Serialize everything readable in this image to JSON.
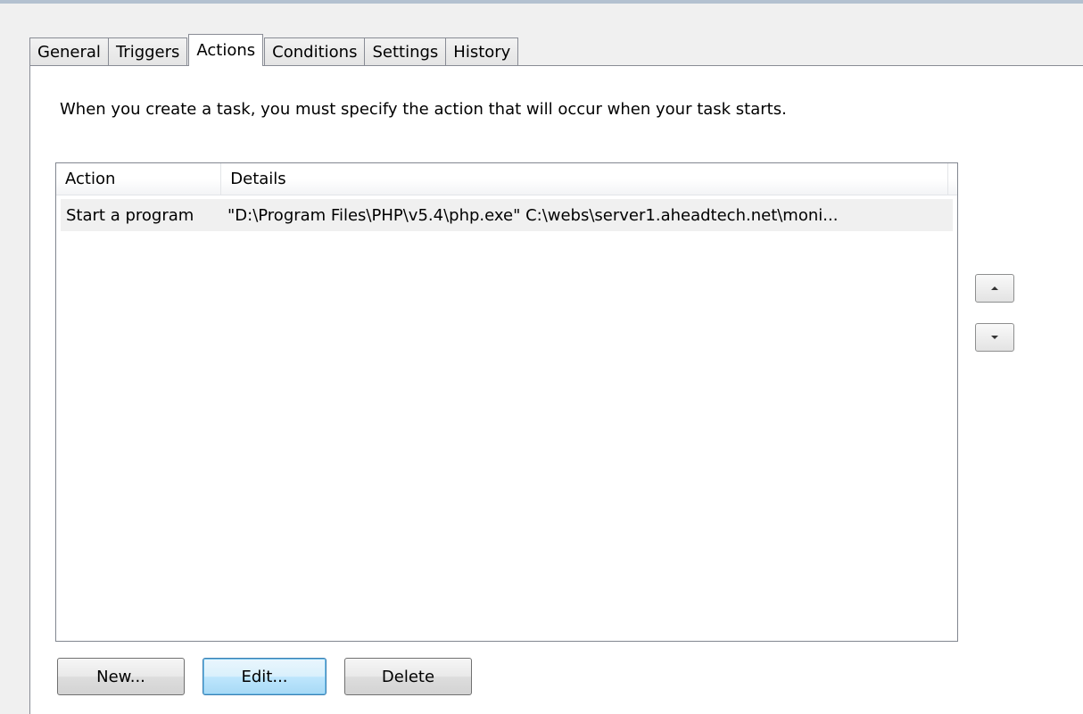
{
  "tabs": [
    {
      "label": "General"
    },
    {
      "label": "Triggers"
    },
    {
      "label": "Actions"
    },
    {
      "label": "Conditions"
    },
    {
      "label": "Settings"
    },
    {
      "label": "History"
    }
  ],
  "active_tab": "Actions",
  "description": "When you create a task, you must specify the action that will occur when your task starts.",
  "list": {
    "columns": [
      "Action",
      "Details"
    ],
    "rows": [
      {
        "action": "Start a program",
        "details": "\"D:\\Program Files\\PHP\\v5.4\\php.exe\" C:\\webs\\server1.aheadtech.net\\moni..."
      }
    ]
  },
  "buttons": {
    "new": "New...",
    "edit": "Edit...",
    "delete": "Delete"
  },
  "icons": {
    "move_up": "arrow-up-icon",
    "move_down": "arrow-down-icon"
  }
}
